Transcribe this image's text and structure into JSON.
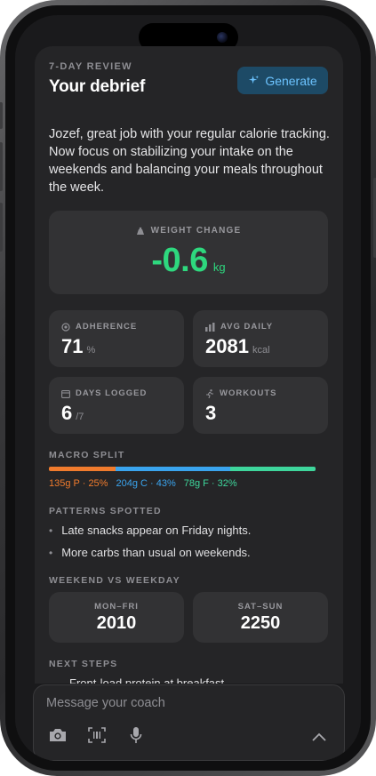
{
  "debrief": {
    "eyebrow": "7-DAY REVIEW",
    "title": "Your debrief",
    "generate_label": "Generate",
    "summary": "Jozef, great job with your regular calorie tracking. Now focus on stabilizing your intake on the weekends and balancing your meals throughout the week."
  },
  "weight_change": {
    "label": "WEIGHT CHANGE",
    "value": "-0.6",
    "unit": "kg"
  },
  "stats": {
    "adherence": {
      "label": "ADHERENCE",
      "value": "71",
      "unit": "%"
    },
    "avg_daily": {
      "label": "AVG DAILY",
      "value": "2081",
      "unit": "kcal"
    },
    "days_logged": {
      "label": "DAYS LOGGED",
      "value": "6",
      "unit": "/7"
    },
    "workouts": {
      "label": "WORKOUTS",
      "value": "3"
    }
  },
  "macro_split": {
    "label": "MACRO SPLIT",
    "protein": {
      "text": "135g P · 25%",
      "percent": 25,
      "color": "#f07b2d"
    },
    "carbs": {
      "text": "204g C · 43%",
      "percent": 43,
      "color": "#3aa4ee"
    },
    "fat": {
      "text": "78g F · 32%",
      "percent": 32,
      "color": "#3ed69c"
    }
  },
  "patterns": {
    "label": "PATTERNS SPOTTED",
    "items": [
      "Late snacks appear on Friday nights.",
      "More carbs than usual on weekends."
    ]
  },
  "weekend_vs_weekday": {
    "label": "WEEKEND VS WEEKDAY",
    "weekday": {
      "label": "MON–FRI",
      "value": "2010"
    },
    "weekend": {
      "label": "SAT–SUN",
      "value": "2250"
    }
  },
  "next_steps": {
    "label": "NEXT STEPS",
    "items": [
      "Front-load protein at breakfast."
    ]
  },
  "composer": {
    "placeholder": "Message your coach"
  },
  "colors": {
    "accent_green": "#2ed87e",
    "accent_blue": "#6cc3ff",
    "screen_bg": "#1a1a1c",
    "card_bg": "#252527",
    "tile_bg": "#323234"
  }
}
